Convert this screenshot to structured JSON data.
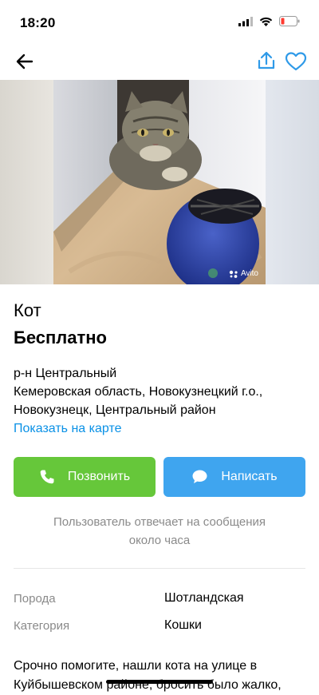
{
  "status": {
    "time": "18:20"
  },
  "nav": {
    "back_icon": "back-arrow-icon",
    "share_icon": "share-icon",
    "favorite_icon": "heart-icon"
  },
  "gallery": {
    "watermark": "Avito"
  },
  "listing": {
    "title": "Кот",
    "price": "Бесплатно",
    "address_line1": "р-н Центральный",
    "address_line2": "Кемеровская область, Новокузнецкий г.о.,",
    "address_line3": "Новокузнецк, Центральный район",
    "map_link": "Показать на карте"
  },
  "actions": {
    "call_label": "Позвонить",
    "message_label": "Написать",
    "call_color": "#66c73a",
    "message_color": "#3fa5ef"
  },
  "response_hint": {
    "line1": "Пользователь отвечает на сообщения",
    "line2": "около часа"
  },
  "params": [
    {
      "label": "Порода",
      "value": "Шотландская"
    },
    {
      "label": "Категория",
      "value": "Кошки"
    }
  ],
  "description": {
    "line1": "Срочно помогите, нашли кота на улице в",
    "line2": "Куйбышевском районе, бросить было жалко,"
  }
}
